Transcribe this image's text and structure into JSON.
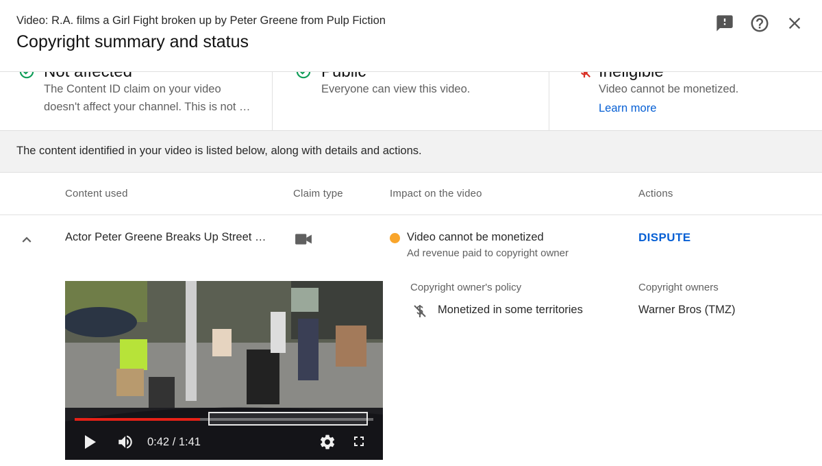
{
  "header": {
    "video_title": "Video: R.A. films a Girl Fight broken up by Peter Greene from Pulp Fiction",
    "page_title": "Copyright summary and status"
  },
  "status_cards": [
    {
      "heading": "Not affected",
      "icon": "check-circle-icon",
      "desc_line1": "The Content ID claim on your video",
      "desc_line2": "doesn't affect your channel. This is not …"
    },
    {
      "heading": "Public",
      "icon": "check-circle-icon",
      "desc_line1": "Everyone can view this video."
    },
    {
      "heading": "Ineligible",
      "icon": "dollar-off-icon",
      "desc_line1": "Video cannot be monetized.",
      "link": "Learn more"
    }
  ],
  "banner": {
    "text": "The content identified in your video is listed below, along with details and actions."
  },
  "table": {
    "headers": {
      "content_used": "Content used",
      "claim_type": "Claim type",
      "impact": "Impact on the video",
      "actions": "Actions"
    },
    "row": {
      "title": "Actor Peter Greene Breaks Up Street Fi…",
      "claim_type_icon": "video-camera-icon",
      "impact_status": "Video cannot be monetized",
      "impact_color": "#f9a52b",
      "impact_sub": "Ad revenue paid to copyright owner",
      "action": "DISPUTE"
    },
    "details": {
      "policy_label": "Copyright owner's policy",
      "policy_value": "Monetized in some territories",
      "owners_label": "Copyright owners",
      "owners_value": "Warner Bros (TMZ)"
    }
  },
  "player": {
    "time": "0:42 / 1:41",
    "progress": 0.42
  },
  "colors": {
    "accent": "#065fd4",
    "progress": "#e62117",
    "success": "#0f9d58",
    "warning": "#f9a52b"
  }
}
